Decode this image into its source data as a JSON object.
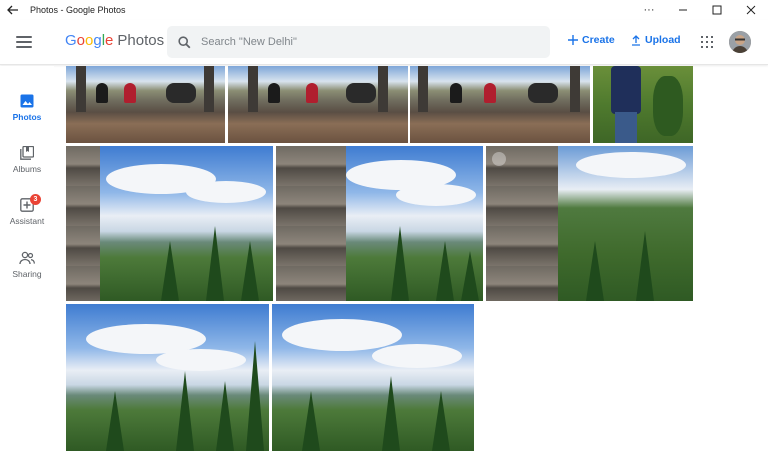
{
  "window": {
    "title": "Photos - Google Photos",
    "controls": {
      "more": "···",
      "minimize": "—",
      "maximize": "☐",
      "close": "✕"
    }
  },
  "appbar": {
    "logo_google": [
      "G",
      "o",
      "o",
      "g",
      "l",
      "e"
    ],
    "logo_photos": "Photos",
    "search_placeholder": "Search \"New Delhi\"",
    "create_label": "Create",
    "upload_label": "Upload"
  },
  "sidebar": {
    "items": [
      {
        "label": "Photos",
        "icon": "photos-icon",
        "active": true
      },
      {
        "label": "Albums",
        "icon": "albums-icon",
        "active": false
      },
      {
        "label": "Assistant",
        "icon": "assistant-icon",
        "active": false,
        "badge": "3"
      },
      {
        "label": "Sharing",
        "icon": "sharing-icon",
        "active": false
      }
    ]
  },
  "colors": {
    "accent": "#1a73e8",
    "badge": "#ea4335",
    "google_blue": "#4285f4",
    "google_red": "#ea4335",
    "google_yellow": "#fbbc05",
    "google_green": "#34a853"
  }
}
